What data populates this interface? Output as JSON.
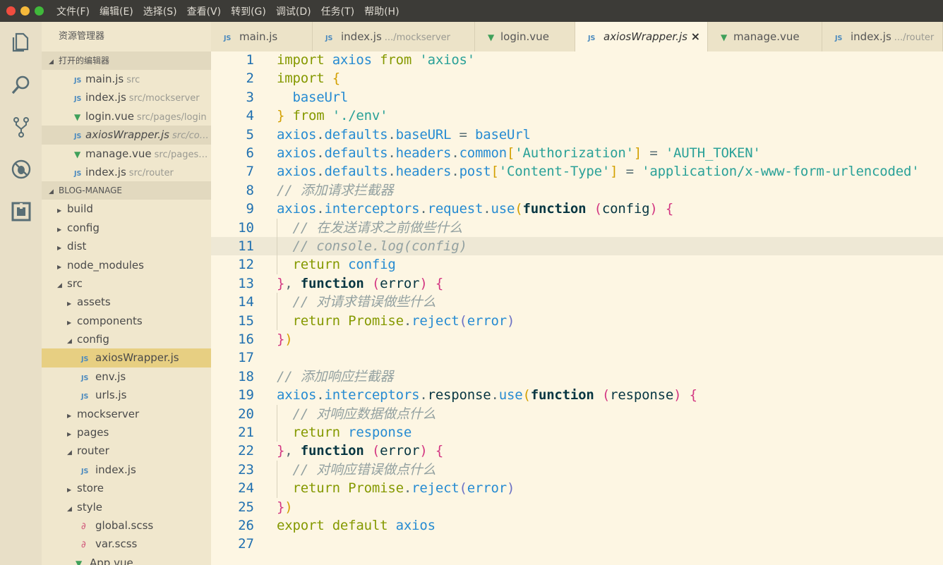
{
  "window": {
    "menu": [
      "文件(F)",
      "编辑(E)",
      "选择(S)",
      "查看(V)",
      "转到(G)",
      "调试(D)",
      "任务(T)",
      "帮助(H)"
    ]
  },
  "activity_bar": [
    "explorer-icon",
    "search-icon",
    "source-control-icon",
    "debug-icon",
    "extensions-icon"
  ],
  "sidebar": {
    "title": "资源管理器",
    "open_editors_label": "打开的编辑器",
    "open_editors": [
      {
        "icon": "js",
        "name": "main.js",
        "desc": "src"
      },
      {
        "icon": "js",
        "name": "index.js",
        "desc": "src/mockserver"
      },
      {
        "icon": "vue",
        "name": "login.vue",
        "desc": "src/pages/login"
      },
      {
        "icon": "js",
        "name": "axiosWrapper.js",
        "desc": "src/co…"
      },
      {
        "icon": "vue",
        "name": "manage.vue",
        "desc": "src/pages…"
      },
      {
        "icon": "js",
        "name": "index.js",
        "desc": "src/router"
      }
    ],
    "project_label": "BLOG-MANAGE",
    "tree": [
      {
        "name": "build",
        "type": "folder",
        "open": false
      },
      {
        "name": "config",
        "type": "folder",
        "open": false
      },
      {
        "name": "dist",
        "type": "folder",
        "open": false
      },
      {
        "name": "node_modules",
        "type": "folder",
        "open": false
      },
      {
        "name": "src",
        "type": "folder",
        "open": true
      },
      {
        "name": "assets",
        "type": "folder",
        "open": false
      },
      {
        "name": "components",
        "type": "folder",
        "open": false
      },
      {
        "name": "config",
        "type": "folder",
        "open": true
      },
      {
        "name": "axiosWrapper.js",
        "type": "js"
      },
      {
        "name": "env.js",
        "type": "js"
      },
      {
        "name": "urls.js",
        "type": "js"
      },
      {
        "name": "mockserver",
        "type": "folder",
        "open": false
      },
      {
        "name": "pages",
        "type": "folder",
        "open": false
      },
      {
        "name": "router",
        "type": "folder",
        "open": true
      },
      {
        "name": "index.js",
        "type": "js"
      },
      {
        "name": "store",
        "type": "folder",
        "open": false
      },
      {
        "name": "style",
        "type": "folder",
        "open": true
      },
      {
        "name": "global.scss",
        "type": "scss"
      },
      {
        "name": "var.scss",
        "type": "scss"
      },
      {
        "name": "App.vue",
        "type": "vue"
      }
    ]
  },
  "tabs": [
    {
      "name": "main.js",
      "desc": "",
      "icon": "js"
    },
    {
      "name": "index.js",
      "desc": ".../mockserver",
      "icon": "js"
    },
    {
      "name": "login.vue",
      "desc": "",
      "icon": "vue"
    },
    {
      "name": "axiosWrapper.js",
      "desc": "",
      "icon": "js",
      "active": true,
      "close": "×"
    },
    {
      "name": "manage.vue",
      "desc": "",
      "icon": "vue"
    },
    {
      "name": "index.js",
      "desc": ".../router",
      "icon": "js"
    }
  ],
  "editor": {
    "current_line": 11,
    "line_numbers": [
      "1",
      "2",
      "3",
      "4",
      "5",
      "6",
      "7",
      "8",
      "9",
      "10",
      "11",
      "12",
      "13",
      "14",
      "15",
      "16",
      "17",
      "18",
      "19",
      "20",
      "21",
      "22",
      "23",
      "24",
      "25",
      "26",
      "27"
    ],
    "lines": [
      "import axios from 'axios'",
      "import {",
      "  baseUrl",
      "} from './env'",
      "axios.defaults.baseURL = baseUrl",
      "axios.defaults.headers.common['Authorization'] = 'AUTH_TOKEN'",
      "axios.defaults.headers.post['Content-Type'] = 'application/x-www-form-urlencoded'",
      "// 添加请求拦截器",
      "axios.interceptors.request.use(function (config) {",
      "  // 在发送请求之前做些什么",
      "  // console.log(config)",
      "  return config",
      "}, function (error) {",
      "  // 对请求错误做些什么",
      "  return Promise.reject(error)",
      "})",
      "",
      "// 添加响应拦截器",
      "axios.interceptors.response.use(function (response) {",
      "  // 对响应数据做点什么",
      "  return response",
      "}, function (error) {",
      "  // 对响应错误做点什么",
      "  return Promise.reject(error)",
      "})",
      "export default axios",
      ""
    ]
  }
}
